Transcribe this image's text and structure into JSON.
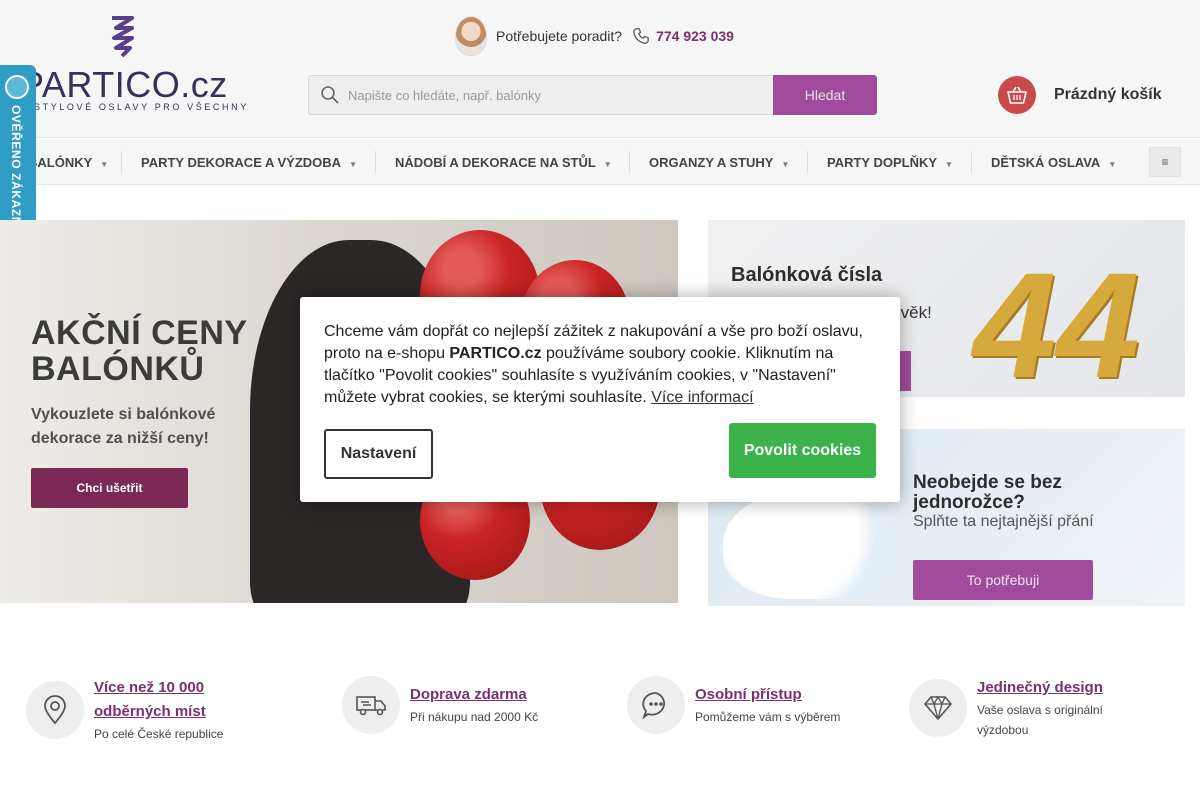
{
  "header": {
    "logo_text": "PARTICO.cz",
    "logo_tagline": "STYLOVÉ OSLAVY PRO VŠECHNY",
    "advice_text": "Potřebujete poradit?",
    "phone": "774 923 039",
    "search_placeholder": "Napište co hledáte, např. balónky",
    "search_button": "Hledat",
    "cart_label": "Prázdný košík"
  },
  "nav": {
    "items": [
      {
        "label": "BALÓNKY"
      },
      {
        "label": "PARTY DEKORACE A VÝZDOBA"
      },
      {
        "label": "NÁDOBÍ A DEKORACE NA STŮL"
      },
      {
        "label": "ORGANZY A STUHY"
      },
      {
        "label": "PARTY DOPLŇKY"
      },
      {
        "label": "DĚTSKÁ OSLAVA"
      }
    ],
    "caret": "▼",
    "more_icon": "≡"
  },
  "badge": {
    "text": "OVĚŘENO ZÁKAZNÍKY"
  },
  "main_banner": {
    "headline_line1": "AKČNÍ CENY",
    "headline_line2": "BALÓNKŮ",
    "sub_line1": "Vykouzlete si balónkové",
    "sub_line2": "dekorace za nižší ceny!",
    "cta": "Chci ušetřit"
  },
  "side_banner_1": {
    "title": "Balónková čísla",
    "subtitle_fragment": "dý věk!",
    "number": "44"
  },
  "side_banner_2": {
    "title": "Neobejde se bez jednorožce?",
    "subtitle": "Splňte ta nejtajnější přání",
    "cta": "To potřebuji"
  },
  "cookie": {
    "text_part1": "Chceme vám dopřát co nejlepší zážitek z nakupování a vše pro boží oslavu, proto na e-shopu ",
    "brand": "PARTICO.cz",
    "text_part2": " používáme soubory cookie. Kliknutím na tlačítko \"Povolit cookies\" souhlasíte s využíváním cookies, v \"Nastavení\" můžete vybrat cookies, se kterými souhlasíte. ",
    "link": "Více informací",
    "settings_button": "Nastavení",
    "allow_button": "Povolit cookies"
  },
  "features": [
    {
      "title_line1": "Více než 10 000",
      "title_line2": "odběrných míst",
      "subtitle": "Po celé České republice",
      "icon": "map-pin-icon"
    },
    {
      "title_line1": "Doprava zdarma",
      "title_line2": "",
      "subtitle": "Při nákupu nad 2000 Kč",
      "icon": "truck-icon"
    },
    {
      "title_line1": "Osobní přístup",
      "title_line2": "",
      "subtitle": "Pomůžeme vám s výběrem",
      "icon": "chat-icon"
    },
    {
      "title_line1": "Jedinečný design",
      "title_line2": "",
      "subtitle_line1": "Vaše oslava s originální",
      "subtitle_line2": "výzdobou",
      "icon": "diamond-icon"
    }
  ],
  "colors": {
    "brand_purple": "#a04b9b",
    "link_purple": "#7a2f75",
    "allow_green": "#3bb34a",
    "badge_blue": "#2f9dc4"
  }
}
